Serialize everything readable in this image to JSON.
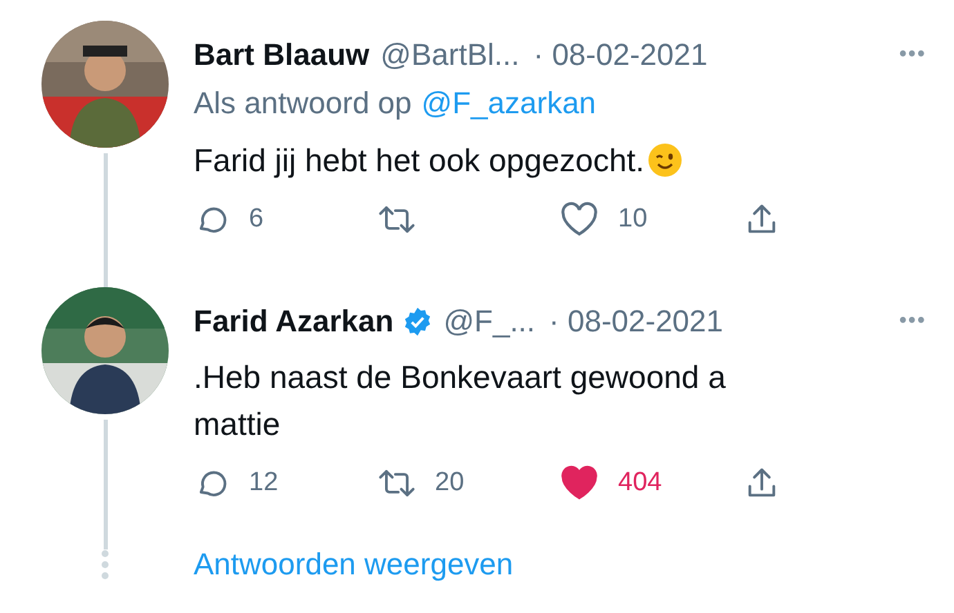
{
  "tweets": [
    {
      "name": "Bart Blaauw",
      "verified": false,
      "handle": "@BartBl...",
      "date": "· 08-02-2021",
      "more": "•••",
      "reply_to": {
        "prefix": "Als antwoord op",
        "user": "@F_azarkan"
      },
      "text": "Farid jij hebt het ook opgezocht.",
      "emoji": true,
      "replies": "6",
      "likes": "10",
      "liked": false
    },
    {
      "name": "Farid Azarkan",
      "verified": true,
      "handle": "@F_...",
      "date": "· 08-02-2021",
      "more": "•••",
      "text": ".Heb naast de Bonkevaart gewoond a mattie",
      "emoji": false,
      "replies": "12",
      "retweets": "20",
      "likes": "404",
      "liked": true
    }
  ],
  "show_replies": "Antwoorden weergeven"
}
